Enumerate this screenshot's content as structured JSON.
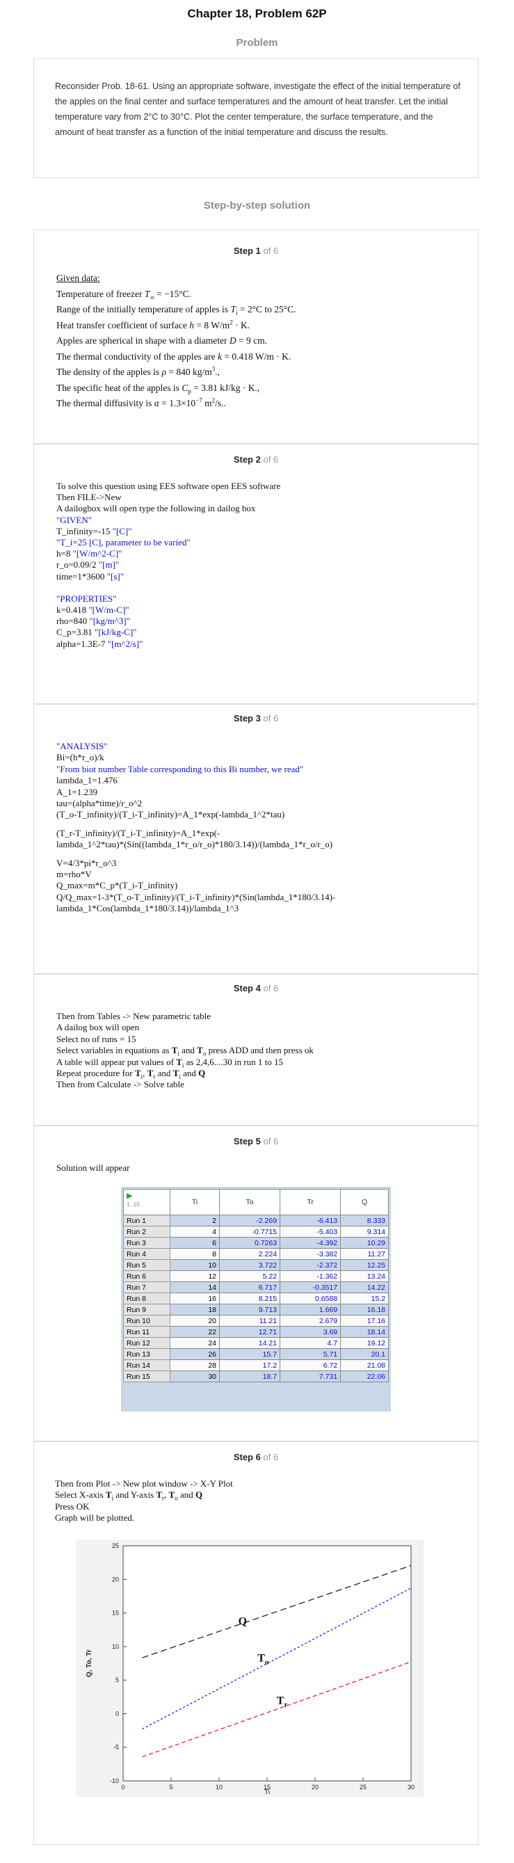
{
  "header": {
    "title": "Chapter 18, Problem 62P",
    "problem_heading": "Problem",
    "solution_heading": "Step-by-step solution"
  },
  "problem": {
    "text": "Reconsider Prob. 18-61. Using an appropriate software, investigate the effect of the initial temperature of the apples on the final center and surface temperatures and the amount of heat transfer. Let the initial temperature vary from 2°C to 30°C. Plot the center temperature, the surface temperature, and the amount of heat transfer as a function of the initial temperature and discuss the results."
  },
  "steps": [
    {
      "label": "Step 1",
      "of": "of 6"
    },
    {
      "label": "Step 2",
      "of": "of 6"
    },
    {
      "label": "Step 3",
      "of": "of 6"
    },
    {
      "label": "Step 4",
      "of": "of 6"
    },
    {
      "label": "Step 5",
      "of": "of 6"
    },
    {
      "label": "Step 6",
      "of": "of 6"
    }
  ],
  "step1": {
    "given": "Given data:",
    "l1a": "Temperature of freezer ",
    "l1b": "T",
    "l1c": "∞",
    "l1d": " = −15°C.",
    "l2a": "Range of the initially temperature of apples is  ",
    "l2b": "T",
    "l2c": "i",
    "l2d": " = 2°C to 25°C.",
    "l3a": "Heat transfer coefficient of surface  ",
    "l3b": "h",
    "l3c": " = 8 W/m",
    "l3d": "2",
    "l3e": " · K.",
    "l4a": "Apples are spherical in shape with a diameter  ",
    "l4b": "D",
    "l4c": " = 9 cm.",
    "l5a": "The thermal conductivity of the apples are  ",
    "l5b": "k",
    "l5c": " = 0.418 W/m · K.",
    "l6a": "The density of the apples is ",
    "l6b": "ρ",
    "l6c": " = 840 kg/m",
    "l6d": "3",
    "l6e": ".,",
    "l7a": "The specific heat of the apples is ",
    "l7b": "C",
    "l7c": "p",
    "l7d": " = 3.81 kJ/kg · K.,",
    "l8a": "The thermal diffusivity is ",
    "l8b": "α",
    "l8c": " = 1.3×10",
    "l8d": "−7",
    "l8e": " m",
    "l8f": "2",
    "l8g": "/s.."
  },
  "step2": {
    "lines": [
      {
        "t": "To solve this question using EES software open EES software",
        "c": ""
      },
      {
        "t": "Then FILE->New",
        "c": ""
      },
      {
        "t": "A dailogbox will open type the following in dailog box",
        "c": ""
      }
    ],
    "given_tag": "\"GIVEN\"",
    "tinf_a": "T_infinity=-15 ",
    "tinf_b": "\"[C]\"",
    "ti_line": "\"T_i=25 [C], parameter to be varied\"",
    "h_a": "h=8 ",
    "h_b": "\"[W/m^2-C]\"",
    "ro_a": "r_o=0.09/2 ",
    "ro_b": "\"[m]\"",
    "time_a": "time=1*3600 ",
    "time_b": "\"[s]\"",
    "props_tag": "\"PROPERTIES\"",
    "k_a": "k=0.418 ",
    "k_b": "\"[W/m-C]\"",
    "rho_a": "rho=840 ",
    "rho_b": "\"[kg/m^3]\"",
    "cp_a": "C_p=3.81 ",
    "cp_b": "\"[kJ/kg-C]\"",
    "alpha_a": "alpha=1.3E-7 ",
    "alpha_b": "\"[m^2/s]\""
  },
  "step3": {
    "analysis": "\"ANALYSIS\"",
    "bi": "Bi=(h*r_o)/k",
    "note": "\"From biot number Table corresponding to this Bi number, we read\"",
    "lambda": "lambda_1=1.476",
    "a1": "A_1=1.239",
    "tau": "tau=(alpha*time)/r_o^2",
    "eq1": "(T_o-T_infinity)/(T_i-T_infinity)=A_1*exp(-lambda_1^2*tau)",
    "eq2a": "(T_r-T_infinity)/(T_i-T_infinity)=A_1*exp(-",
    "eq2b": "lambda_1^2*tau)*(Sin((lambda_1*r_o/r_o)*180/3.14))/(lambda_1*r_o/r_o)",
    "v": "V=4/3*pi*r_o^3",
    "m": "m=rho*V",
    "qmax": "Q_max=m*C_p*(T_i-T_infinity)",
    "q1": "Q/Q_max=1-3*(T_o-T_infinity)/(T_i-T_infinity)*(Sin(lambda_1*180/3.14)-",
    "q2": "lambda_1*Cos(lambda_1*180/3.14))/lambda_1^3"
  },
  "step4": {
    "l1": "Then from Tables -> New parametric table",
    "l2": "A dailog box will open",
    "l3": "Select no of runs = 15",
    "l4a": "Select variables in equations as ",
    "l4b": "T",
    "l4c": "i",
    "l4d": " and ",
    "l4e": "T",
    "l4f": "o",
    "l4g": " press ADD and then press ok",
    "l5a": "A table will appear put values of ",
    "l5b": "T",
    "l5c": "i",
    "l5d": " as 2,4,6....30 in run 1 to 15",
    "l6a": "Repeat procedure for ",
    "l6b": "T",
    "l6c": "i",
    "l6d": ", ",
    "l6e": "T",
    "l6f": "r",
    "l6g": " and ",
    "l6h": "T",
    "l6i": "i",
    "l6j": " and ",
    "l6k": "Q",
    "l7": "Then from Calculate -> Solve table"
  },
  "step5": {
    "intro": "Solution will appear",
    "table": {
      "corner": "1..15",
      "headers": [
        "Ti",
        "To",
        "Tr",
        "Q"
      ],
      "rows": [
        {
          "run": "Run 1",
          "ti": "2",
          "to": "-2.269",
          "tr": "-6.413",
          "q": "8.333"
        },
        {
          "run": "Run 2",
          "ti": "4",
          "to": "-0.7715",
          "tr": "-5.403",
          "q": "9.314"
        },
        {
          "run": "Run 3",
          "ti": "6",
          "to": "0.7263",
          "tr": "-4.392",
          "q": "10.29"
        },
        {
          "run": "Run 4",
          "ti": "8",
          "to": "2.224",
          "tr": "-3.382",
          "q": "11.27"
        },
        {
          "run": "Run 5",
          "ti": "10",
          "to": "3.722",
          "tr": "-2.372",
          "q": "12.25"
        },
        {
          "run": "Run 6",
          "ti": "12",
          "to": "5.22",
          "tr": "-1.362",
          "q": "13.24"
        },
        {
          "run": "Run 7",
          "ti": "14",
          "to": "6.717",
          "tr": "-0.3517",
          "q": "14.22"
        },
        {
          "run": "Run 8",
          "ti": "16",
          "to": "8.215",
          "tr": "0.6588",
          "q": "15.2"
        },
        {
          "run": "Run 9",
          "ti": "18",
          "to": "9.713",
          "tr": "1.669",
          "q": "16.18"
        },
        {
          "run": "Run 10",
          "ti": "20",
          "to": "11.21",
          "tr": "2.679",
          "q": "17.16"
        },
        {
          "run": "Run 11",
          "ti": "22",
          "to": "12.71",
          "tr": "3.69",
          "q": "18.14"
        },
        {
          "run": "Run 12",
          "ti": "24",
          "to": "14.21",
          "tr": "4.7",
          "q": "19.12"
        },
        {
          "run": "Run 13",
          "ti": "26",
          "to": "15.7",
          "tr": "5.71",
          "q": "20.1"
        },
        {
          "run": "Run 14",
          "ti": "28",
          "to": "17.2",
          "tr": "6.72",
          "q": "21.08"
        },
        {
          "run": "Run 15",
          "ti": "30",
          "to": "18.7",
          "tr": "7.731",
          "q": "22.06"
        }
      ]
    }
  },
  "step6": {
    "l1": "Then from Plot -> New plot window -> X-Y Plot",
    "l2a": "Select X-axis ",
    "l2b": "T",
    "l2c": "i",
    "l2d": " and Y-axis ",
    "l2e": "T",
    "l2f": "r",
    "l2g": ", ",
    "l2h": "T",
    "l2i": "o",
    "l2j": " and ",
    "l2k": "Q",
    "l3": "Press OK",
    "l4": "Graph will be plotted."
  },
  "chart_data": {
    "type": "line",
    "x": [
      2,
      30
    ],
    "series": [
      {
        "name": "Q",
        "values": [
          8.333,
          22.06
        ],
        "color": "#222222"
      },
      {
        "name": "To",
        "values": [
          -2.269,
          18.7
        ],
        "color": "#1a1aee"
      },
      {
        "name": "Tr",
        "values": [
          -6.413,
          7.731
        ],
        "color": "#ee2020"
      }
    ],
    "xlabel": "Ti",
    "ylabel": "Q, To, Tr",
    "xlim": [
      0,
      30
    ],
    "ylim": [
      -10,
      25
    ],
    "xticks": [
      "0",
      "5",
      "10",
      "15",
      "20",
      "25",
      "30"
    ],
    "yticks": [
      "25",
      "20",
      "15",
      "10",
      "5",
      "0",
      "-5",
      "-10"
    ],
    "labels": {
      "q": "Q",
      "to": "To",
      "tr": "Tr"
    },
    "grid": false
  }
}
